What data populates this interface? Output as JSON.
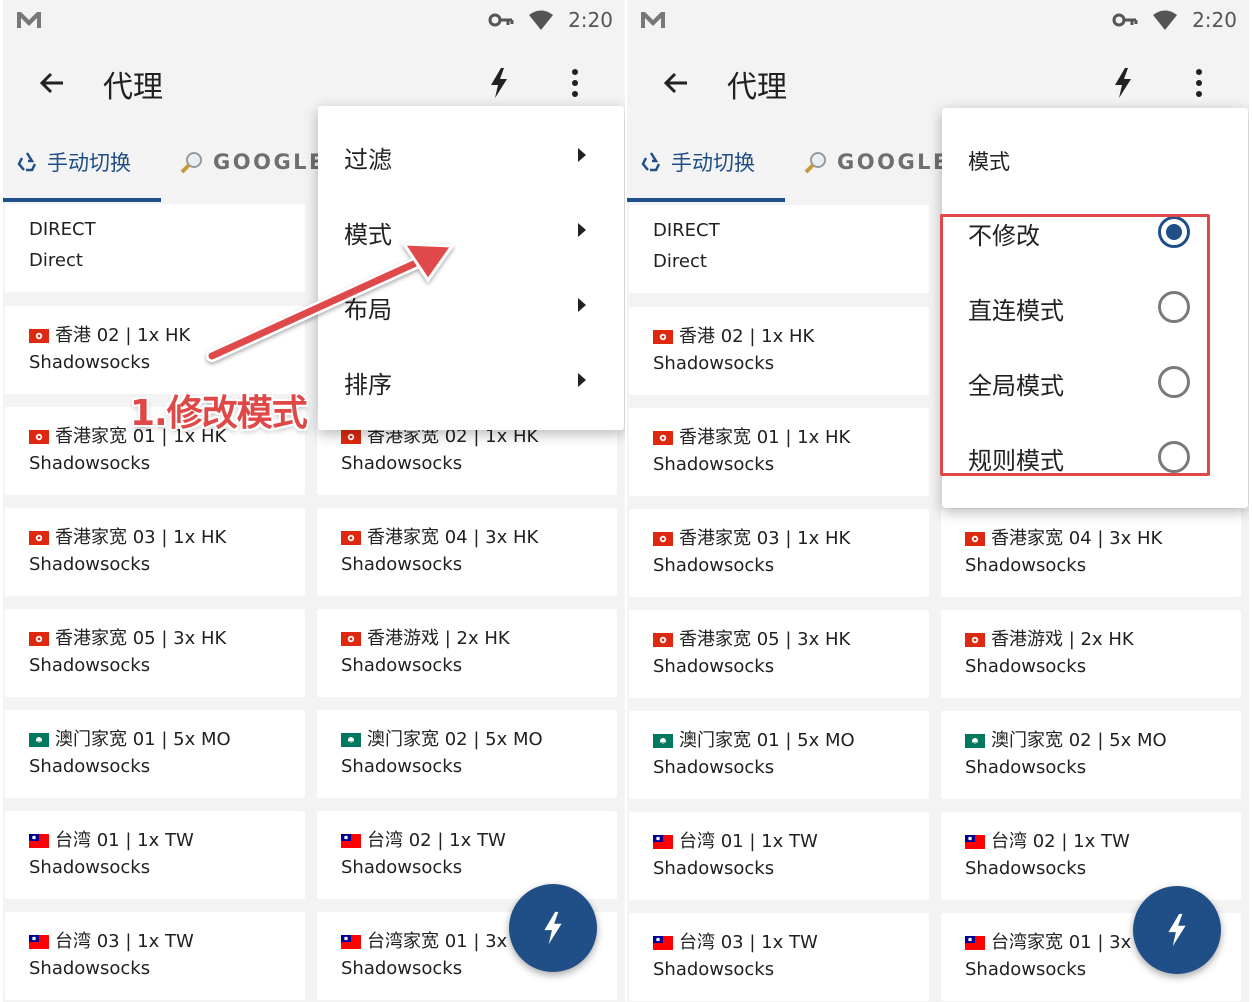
{
  "status": {
    "time": "2:20"
  },
  "appbar": {
    "title": "代理"
  },
  "tabs": [
    {
      "label": "手动切换",
      "icon": "recycle-icon"
    },
    {
      "label": "GOOGLE",
      "icon": "magnifier-icon"
    }
  ],
  "direct": {
    "title": "DIRECT",
    "subtitle": "Direct"
  },
  "proxies": [
    {
      "name": "香港 02 | 1x HK",
      "type": "Shadowsocks",
      "flag": "hk"
    },
    {
      "name": "香港家宽 01 | 1x HK",
      "type": "Shadowsocks",
      "flag": "hk"
    },
    {
      "name": "香港家宽 02 | 1x HK",
      "type": "Shadowsocks",
      "flag": "hk"
    },
    {
      "name": "香港家宽 03 | 1x HK",
      "type": "Shadowsocks",
      "flag": "hk"
    },
    {
      "name": "香港家宽 04 | 3x HK",
      "type": "Shadowsocks",
      "flag": "hk"
    },
    {
      "name": "香港家宽 05 | 3x HK",
      "type": "Shadowsocks",
      "flag": "hk"
    },
    {
      "name": "香港游戏 | 2x HK",
      "type": "Shadowsocks",
      "flag": "hk"
    },
    {
      "name": "澳门家宽 01 | 5x MO",
      "type": "Shadowsocks",
      "flag": "mo"
    },
    {
      "name": "澳门家宽 02 | 5x MO",
      "type": "Shadowsocks",
      "flag": "mo"
    },
    {
      "name": "台湾 01 | 1x TW",
      "type": "Shadowsocks",
      "flag": "tw"
    },
    {
      "name": "台湾 02 | 1x TW",
      "type": "Shadowsocks",
      "flag": "tw"
    },
    {
      "name": "台湾 03 | 1x TW",
      "type": "Shadowsocks",
      "flag": "tw"
    },
    {
      "name": "台湾家宽 01 | 3x",
      "type": "Shadowsocks",
      "flag": "tw"
    }
  ],
  "left_overlay": {
    "title_fragment": "香港家宽 01 | 1x HK"
  },
  "options_menu": [
    {
      "label": "过滤"
    },
    {
      "label": "模式"
    },
    {
      "label": "布局"
    },
    {
      "label": "排序"
    }
  ],
  "mode_menu": {
    "header": "模式",
    "options": [
      {
        "label": "不修改",
        "selected": true
      },
      {
        "label": "直连模式",
        "selected": false
      },
      {
        "label": "全局模式",
        "selected": false
      },
      {
        "label": "规则模式",
        "selected": false
      }
    ]
  },
  "annotation": {
    "text": "1.修改模式",
    "color": "#e04848"
  },
  "colors": {
    "accent": "#1f4f86",
    "annotation": "#e04848",
    "background": "#f3f3f3"
  }
}
